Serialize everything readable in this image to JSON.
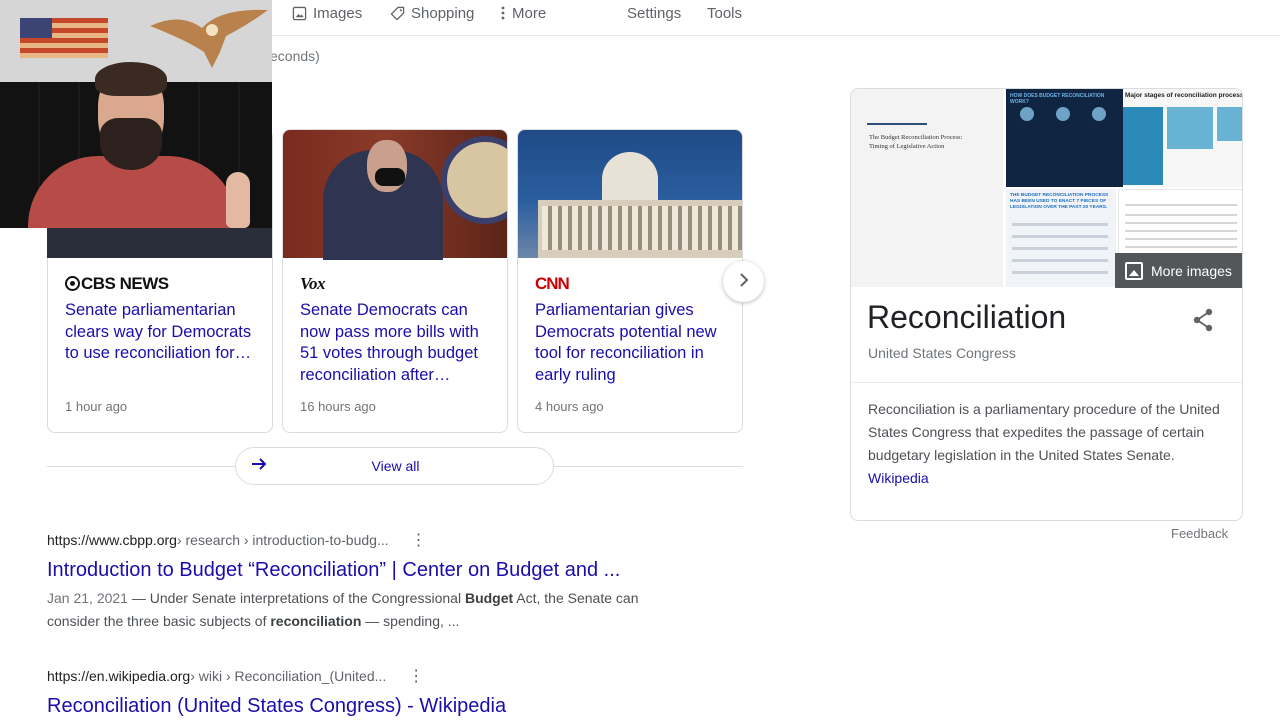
{
  "nav": {
    "images": "Images",
    "shopping": "Shopping",
    "more": "More",
    "settings": "Settings",
    "tools": "Tools"
  },
  "result_stats_partial": "econds)",
  "news": {
    "cards": [
      {
        "source": "CBS NEWS",
        "headline": "Senate parliamentarian clears way for Democrats to use reconciliation for…",
        "age": "1 hour ago"
      },
      {
        "source": "Vox",
        "headline": "Senate Democrats can now pass more bills with 51 votes through budget reconciliation after…",
        "age": "16 hours ago"
      },
      {
        "source": "CNN",
        "headline": "Parliamentarian gives Democrats potential new tool for reconciliation in early ruling",
        "age": "4 hours ago"
      }
    ],
    "next_icon": "chevron-right",
    "view_all": "View all"
  },
  "results": [
    {
      "domain": "https://www.cbpp.org",
      "path": " › research › introduction-to-budg...",
      "title": "Introduction to Budget “Reconciliation” | Center on Budget and ...",
      "date": "Jan 21, 2021",
      "snippet_parts": [
        " — Under Senate interpretations of the Congressional ",
        "Budget",
        " Act, the Senate can consider the three basic subjects of ",
        "reconciliation",
        " — spending, ..."
      ]
    },
    {
      "domain": "https://en.wikipedia.org",
      "path": " › wiki › Reconciliation_(United...",
      "title": "Reconciliation (United States Congress) - Wikipedia"
    }
  ],
  "knowledge_panel": {
    "images": {
      "main_doc_title": "The Budget Reconciliation Process: Timing of Legislative Action",
      "infographic_a_header": "HOW DOES BUDGET RECONCILIATION WORK?",
      "infographic_b_header": "Major stages of reconciliation process",
      "infographic_c_header": "THE BUDGET RECONCILIATION PROCESS HAS BEEN USED TO ENACT 7 PIECES OF LEGISLATION OVER THE PAST 20 YEARS.",
      "more_images": "More images"
    },
    "title": "Reconciliation",
    "subtitle": "United States Congress",
    "description": "Reconciliation is a parliamentary procedure of the United States Congress that expedites the passage of certain budgetary legislation in the United States Senate. ",
    "source_link": "Wikipedia",
    "feedback": "Feedback"
  },
  "colors": {
    "link": "#1a0dab",
    "cnn_red": "#cc0000"
  }
}
